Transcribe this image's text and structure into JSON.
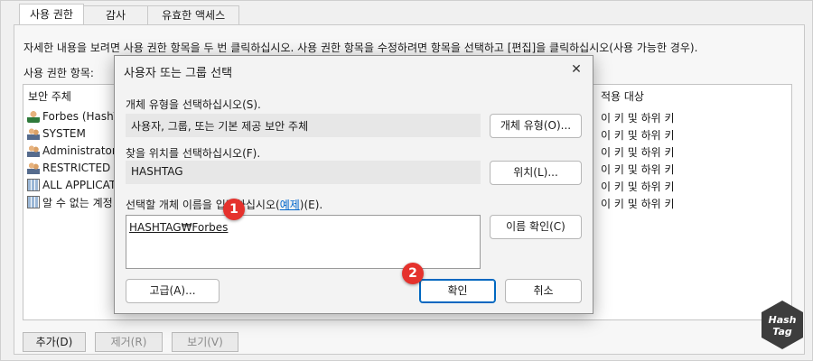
{
  "tabs": [
    {
      "label": "사용 권한",
      "active": true
    },
    {
      "label": "감사",
      "active": false
    },
    {
      "label": "유효한 액세스",
      "active": false
    }
  ],
  "description": "자세한 내용을 보려면 사용 권한 항목을 두 번 클릭하십시오. 사용 권한 항목을 수정하려면 항목을 선택하고 [편집]을 클릭하십시오(사용 가능한 경우).",
  "entries_label": "사용 권한 항목:",
  "list": {
    "columns": {
      "principal": "보안 주체",
      "applies_to": "적용 대상"
    },
    "rows": [
      {
        "icon": "user-icon",
        "principal": "Forbes (HashTa",
        "applies_to": "이 키 및 하위 키"
      },
      {
        "icon": "group-icon",
        "principal": "SYSTEM",
        "applies_to": "이 키 및 하위 키"
      },
      {
        "icon": "group-icon",
        "principal": "Administrators",
        "applies_to": "이 키 및 하위 키"
      },
      {
        "icon": "group-icon",
        "principal": "RESTRICTED",
        "applies_to": "이 키 및 하위 키"
      },
      {
        "icon": "app-package-icon",
        "principal": "ALL APPLICATIO",
        "applies_to": "이 키 및 하위 키"
      },
      {
        "icon": "app-package-icon",
        "principal": "알 수 없는 계정",
        "applies_to": "이 키 및 하위 키"
      }
    ]
  },
  "bottom_buttons": {
    "add": "추가(D)",
    "remove": "제거(R)",
    "view": "보기(V)"
  },
  "dialog": {
    "title": "사용자 또는 그룹 선택",
    "close": "✕",
    "object_type_label": "개체 유형을 선택하십시오(S).",
    "object_type_value": "사용자, 그룹, 또는 기본 제공 보안 주체",
    "object_type_button": "개체 유형(O)...",
    "location_label": "찾을 위치를 선택하십시오(F).",
    "location_value": "HASHTAG",
    "location_button": "위치(L)...",
    "names_label_pre": "선택할 개체 이름을 입력하십시오(",
    "names_label_link": "예제",
    "names_label_post": ")(E).",
    "names_value": "HASHTAG₩Forbes",
    "check_names_button": "이름 확인(C)",
    "advanced_button": "고급(A)...",
    "ok_button": "확인",
    "cancel_button": "취소"
  },
  "annotations": {
    "step1": "1",
    "step2": "2"
  },
  "watermark": {
    "line1": "Hash",
    "line2": "Tag"
  }
}
